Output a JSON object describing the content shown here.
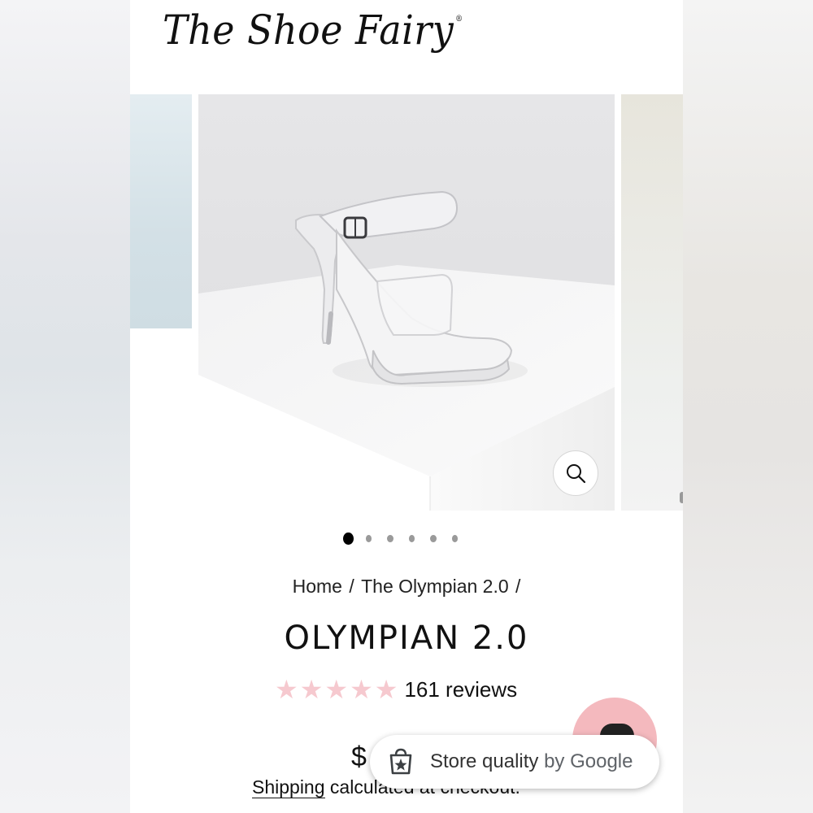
{
  "brand": {
    "logo_text": "The Shoe Fairy"
  },
  "gallery": {
    "image_alt": "Clear platform stiletto sandal with ankle strap on white pedestal",
    "zoom_icon": "search-icon",
    "slide_count": 6,
    "active_slide": 1
  },
  "breadcrumb": {
    "home": "Home",
    "sep1": "/",
    "current": "The Olympian 2.0",
    "sep2": "/"
  },
  "product": {
    "title": "OLYMPIAN 2.0",
    "rating_stars": 5,
    "reviews": "161 reviews",
    "price_visible": "$",
    "shipping_link": "Shipping",
    "shipping_rest": "calculated at checkout."
  },
  "badge": {
    "text": "Store quality",
    "by": "by Google"
  },
  "colors": {
    "star": "#f6c9cf",
    "chat_fab": "#f4b9be",
    "text": "#111111"
  }
}
